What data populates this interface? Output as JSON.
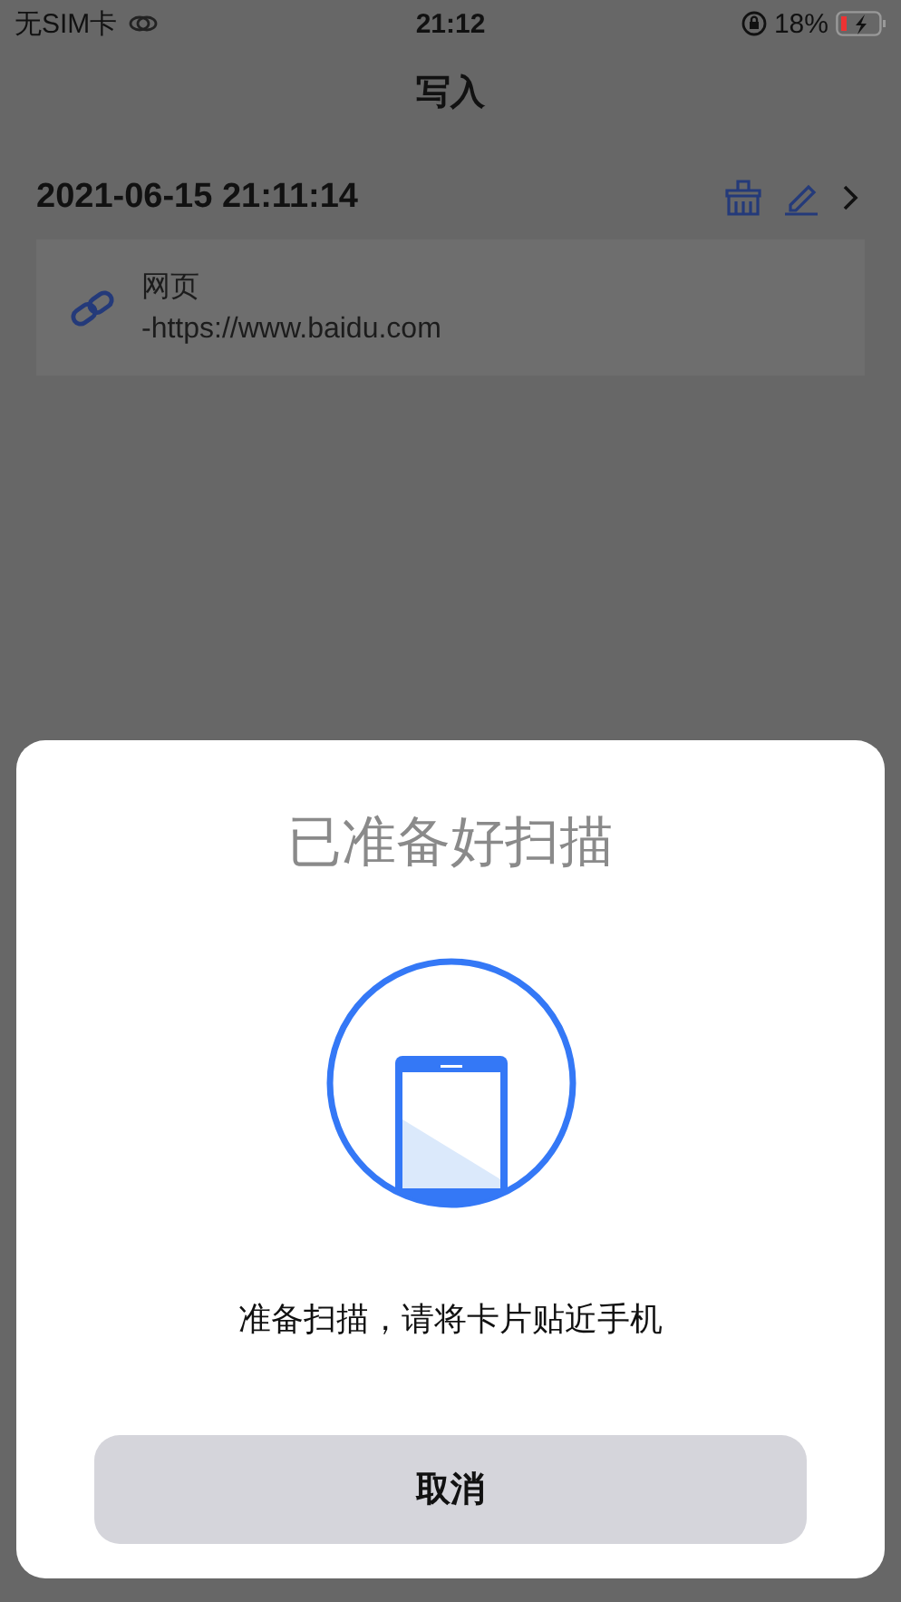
{
  "status_bar": {
    "carrier": "无SIM卡",
    "time": "21:12",
    "battery": "18%"
  },
  "nav": {
    "title": "写入"
  },
  "record": {
    "timestamp": "2021-06-15 21:11:14",
    "type": "网页",
    "content": "-https://www.baidu.com"
  },
  "scan_sheet": {
    "title": "已准备好扫描",
    "message": "准备扫描，请将卡片贴近手机",
    "cancel": "取消"
  }
}
